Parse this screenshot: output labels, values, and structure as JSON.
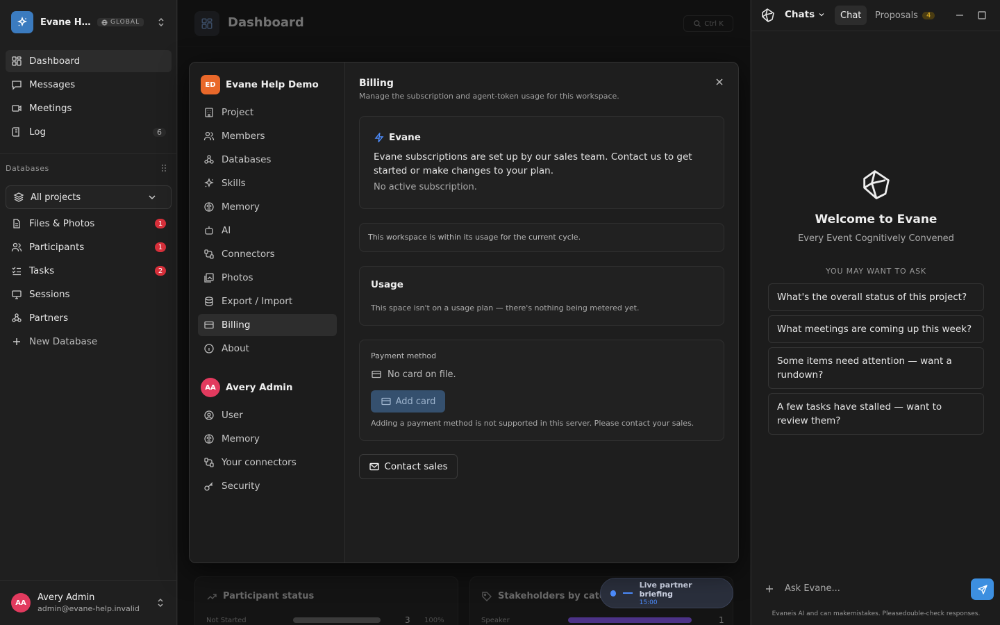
{
  "workspace": {
    "name": "Evane Help Demo",
    "name_short": "Evane He...",
    "badge": "GLOBAL"
  },
  "nav": [
    {
      "label": "Dashboard",
      "icon": "dashboard-icon",
      "active": true
    },
    {
      "label": "Messages",
      "icon": "message-icon"
    },
    {
      "label": "Meetings",
      "icon": "video-icon"
    },
    {
      "label": "Log",
      "icon": "log-icon",
      "count": "6"
    }
  ],
  "databases": {
    "section_label": "Databases",
    "project_select": "All projects",
    "items": [
      {
        "label": "Files & Photos",
        "badge": "1"
      },
      {
        "label": "Participants",
        "badge": "1"
      },
      {
        "label": "Tasks",
        "badge": "2"
      },
      {
        "label": "Sessions"
      },
      {
        "label": "Partners"
      }
    ],
    "new_label": "New Database"
  },
  "user": {
    "initials": "AA",
    "name": "Avery Admin",
    "email": "admin@evane-help.invalid"
  },
  "main": {
    "title": "Dashboard",
    "shortcut": "Ctrl K",
    "card1": {
      "title": "Participant status",
      "row_label": "Not Started",
      "row_value": "3",
      "row_pct": "100%"
    },
    "card2": {
      "title": "Stakeholders by categ",
      "row_label": "Speaker",
      "row_value": "1"
    },
    "live": {
      "title": "Live partner briefing",
      "time": "15:00"
    }
  },
  "modal": {
    "project_group": {
      "initials": "ED",
      "name": "Evane Help Demo"
    },
    "project_items": [
      "Project",
      "Members",
      "Databases",
      "Skills",
      "Memory",
      "AI",
      "Connectors",
      "Photos",
      "Export / Import",
      "Billing",
      "About"
    ],
    "user_group": {
      "initials": "AA",
      "name": "Avery Admin"
    },
    "user_items": [
      "User",
      "Memory",
      "Your connectors",
      "Security"
    ],
    "active_item": "Billing",
    "title": "Billing",
    "subtitle": "Manage the subscription and agent-token usage for this workspace.",
    "evane_card": {
      "title": "Evane",
      "text": "Evane subscriptions are set up by our sales team. Contact us to get started or make changes to your plan.",
      "status": "No active subscription."
    },
    "usage_notice": "This workspace is within its usage for the current cycle.",
    "usage_card": {
      "title": "Usage",
      "text": "This space isn't on a usage plan — there's nothing being metered yet."
    },
    "payment_card": {
      "label": "Payment method",
      "no_card": "No card on file.",
      "add_button": "Add card",
      "note": "Adding a payment method is not supported in this server. Please contact your sales."
    },
    "contact_button": "Contact sales"
  },
  "chat": {
    "chats_label": "Chats",
    "tabs": [
      {
        "label": "Chat",
        "active": true
      },
      {
        "label": "Proposals",
        "badge": "4"
      }
    ],
    "welcome_title": "Welcome to Evane",
    "welcome_subtitle": "Every Event Cognitively Convened",
    "ask_label": "YOU MAY WANT TO ASK",
    "suggestions": [
      "What's the overall status of this project?",
      "What meetings are coming up this week?",
      "Some items need attention — want a rundown?",
      "A few tasks have stalled — want to review them?"
    ],
    "input_placeholder": "Ask Evane...",
    "disclaimer": "Evaneis AI and can makemistakes. Pleasedouble-check responses."
  },
  "colors": {
    "accent": "#3d8fe0",
    "badge_red": "#d8303b",
    "workspace_logo": "#3b7bbf",
    "project_avatar": "#e9682a",
    "user_avatar": "#e23a5e",
    "proposals_badge": "#e7b627"
  }
}
